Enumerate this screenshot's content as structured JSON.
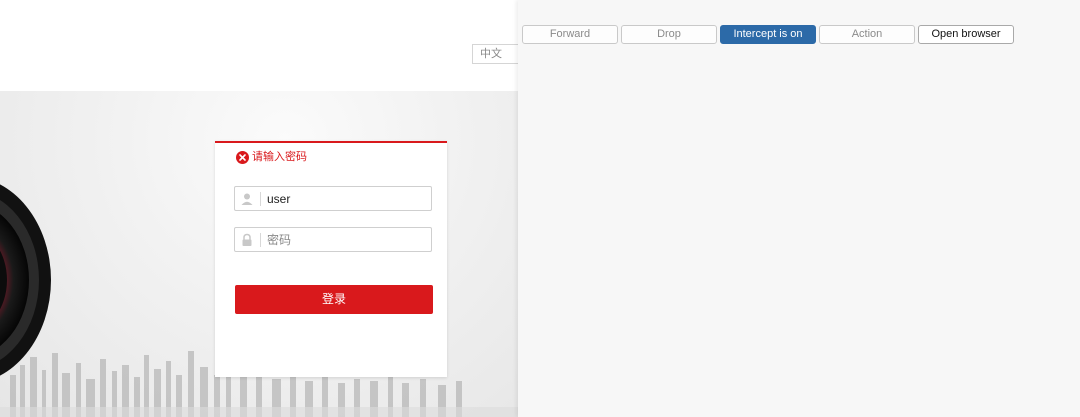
{
  "login_page": {
    "language": "中文",
    "error_message": "请输入密码",
    "username_value": "user",
    "password_placeholder": "密码",
    "login_button": "登录",
    "colors": {
      "accent": "#d9191c"
    },
    "icons": {
      "error": "error-circle-icon",
      "user": "user-icon",
      "password": "lock-icon"
    }
  },
  "proxy_toolbar": {
    "forward": "Forward",
    "drop": "Drop",
    "intercept": "Intercept is on",
    "action": "Action",
    "open_browser": "Open browser",
    "colors": {
      "intercept_active": "#2c6aa8"
    }
  }
}
